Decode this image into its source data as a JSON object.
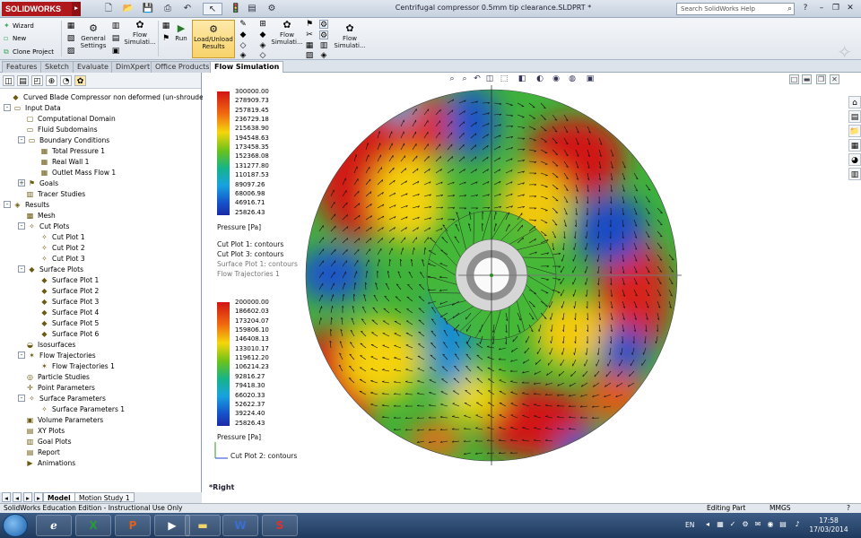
{
  "app": {
    "logo": "SOLIDWORKS",
    "doc_title": "Centrifugal compressor 0.5mm tip clearance.SLDPRT *",
    "search_placeholder": "Search SolidWorks Help"
  },
  "ribbon": {
    "left_buttons": [
      "Wizard",
      "New",
      "Clone Project"
    ],
    "general_settings": [
      "General",
      "Settings"
    ],
    "flow_sim_1": [
      "Flow",
      "Simulati..."
    ],
    "run": "Run",
    "load_unload": [
      "Load/Unload",
      "Results"
    ],
    "flow_sim_2": [
      "Flow",
      "Simulati..."
    ],
    "flow_sim_3": [
      "Flow",
      "Simulati..."
    ]
  },
  "tabs": [
    "Features",
    "Sketch",
    "Evaluate",
    "DimXpert",
    "Office Products",
    "Flow Simulation"
  ],
  "active_tab": "Flow Simulation",
  "tree": [
    {
      "label": "Curved Blade Compressor non deformed (un-shrouded) bl",
      "level": 0,
      "icon": "part-icon",
      "expander": ""
    },
    {
      "label": "Input Data",
      "level": 0,
      "icon": "folder-icon",
      "expander": "-"
    },
    {
      "label": "Computational Domain",
      "level": 1,
      "icon": "domain-icon",
      "expander": ""
    },
    {
      "label": "Fluid Subdomains",
      "level": 1,
      "icon": "folder-icon",
      "expander": ""
    },
    {
      "label": "Boundary Conditions",
      "level": 1,
      "icon": "folder-icon",
      "expander": "-"
    },
    {
      "label": "Total Pressure 1",
      "level": 2,
      "icon": "boundary-icon",
      "expander": ""
    },
    {
      "label": "Real Wall 1",
      "level": 2,
      "icon": "boundary-icon",
      "expander": ""
    },
    {
      "label": "Outlet Mass Flow 1",
      "level": 2,
      "icon": "boundary-icon",
      "expander": ""
    },
    {
      "label": "Goals",
      "level": 1,
      "icon": "goal-icon",
      "expander": "+"
    },
    {
      "label": "Tracer Studies",
      "level": 1,
      "icon": "tracer-icon",
      "expander": ""
    },
    {
      "label": "Results",
      "level": 0,
      "icon": "results-icon",
      "expander": "-"
    },
    {
      "label": "Mesh",
      "level": 1,
      "icon": "mesh-icon",
      "expander": ""
    },
    {
      "label": "Cut Plots",
      "level": 1,
      "icon": "cutplot-icon",
      "expander": "-"
    },
    {
      "label": "Cut Plot 1",
      "level": 2,
      "icon": "cutplot-icon",
      "expander": ""
    },
    {
      "label": "Cut Plot 2",
      "level": 2,
      "icon": "cutplot-icon",
      "expander": ""
    },
    {
      "label": "Cut Plot 3",
      "level": 2,
      "icon": "cutplot-icon",
      "expander": ""
    },
    {
      "label": "Surface Plots",
      "level": 1,
      "icon": "surfaceplot-icon",
      "expander": "-"
    },
    {
      "label": "Surface Plot 1",
      "level": 2,
      "icon": "surfaceplot-icon",
      "expander": ""
    },
    {
      "label": "Surface Plot 2",
      "level": 2,
      "icon": "surfaceplot-icon",
      "expander": ""
    },
    {
      "label": "Surface Plot 3",
      "level": 2,
      "icon": "surfaceplot-icon",
      "expander": ""
    },
    {
      "label": "Surface Plot 4",
      "level": 2,
      "icon": "surfaceplot-icon",
      "expander": ""
    },
    {
      "label": "Surface Plot 5",
      "level": 2,
      "icon": "surfaceplot-icon",
      "expander": ""
    },
    {
      "label": "Surface Plot 6",
      "level": 2,
      "icon": "surfaceplot-icon",
      "expander": ""
    },
    {
      "label": "Isosurfaces",
      "level": 1,
      "icon": "isosurface-icon",
      "expander": ""
    },
    {
      "label": "Flow Trajectories",
      "level": 1,
      "icon": "trajectory-icon",
      "expander": "-"
    },
    {
      "label": "Flow Trajectories 1",
      "level": 2,
      "icon": "trajectory-icon",
      "expander": ""
    },
    {
      "label": "Particle Studies",
      "level": 1,
      "icon": "particle-icon",
      "expander": ""
    },
    {
      "label": "Point Parameters",
      "level": 1,
      "icon": "point-icon",
      "expander": ""
    },
    {
      "label": "Surface Parameters",
      "level": 1,
      "icon": "surfaceparam-icon",
      "expander": "-"
    },
    {
      "label": "Surface Parameters 1",
      "level": 2,
      "icon": "surfaceparam-icon",
      "expander": ""
    },
    {
      "label": "Volume Parameters",
      "level": 1,
      "icon": "volume-icon",
      "expander": ""
    },
    {
      "label": "XY Plots",
      "level": 1,
      "icon": "xyplot-icon",
      "expander": ""
    },
    {
      "label": "Goal Plots",
      "level": 1,
      "icon": "goalplot-icon",
      "expander": ""
    },
    {
      "label": "Report",
      "level": 1,
      "icon": "report-icon",
      "expander": ""
    },
    {
      "label": "Animations",
      "level": 1,
      "icon": "animation-icon",
      "expander": ""
    }
  ],
  "bottom_tabs": [
    "Model",
    "Motion Study 1"
  ],
  "legend1": {
    "ticks": [
      "300000.00",
      "278909.73",
      "257819.45",
      "236729.18",
      "215638.90",
      "194548.63",
      "173458.35",
      "152368.08",
      "131277.80",
      "110187.53",
      "89097.26",
      "68006.98",
      "46916.71",
      "25826.43"
    ],
    "unit": "Pressure [Pa]",
    "lines": [
      "Cut Plot 1: contours",
      "Cut Plot 3: contours",
      "Surface Plot 1: contours",
      "Flow Trajectories 1"
    ]
  },
  "legend2": {
    "ticks": [
      "200000.00",
      "186602.03",
      "173204.07",
      "159806.10",
      "146408.13",
      "133010.17",
      "119612.20",
      "106214.23",
      "92816.27",
      "79418.30",
      "66020.33",
      "52622.37",
      "39224.40",
      "25826.43"
    ],
    "unit": "Pressure [Pa]",
    "lines": [
      "Cut Plot 2: contours"
    ]
  },
  "view_label": "*Right",
  "status": {
    "left": "SolidWorks Education Edition - Instructional Use Only",
    "mode": "Editing Part",
    "units": "MMGS",
    "help": "?"
  },
  "taskbar": {
    "lang": "EN",
    "time": "17:58",
    "date": "17/03/2014"
  },
  "colors": {
    "sw_red": "#b0181c",
    "ribbon_bg": "#e8ecf1",
    "taskbar": "#2b4a73"
  }
}
